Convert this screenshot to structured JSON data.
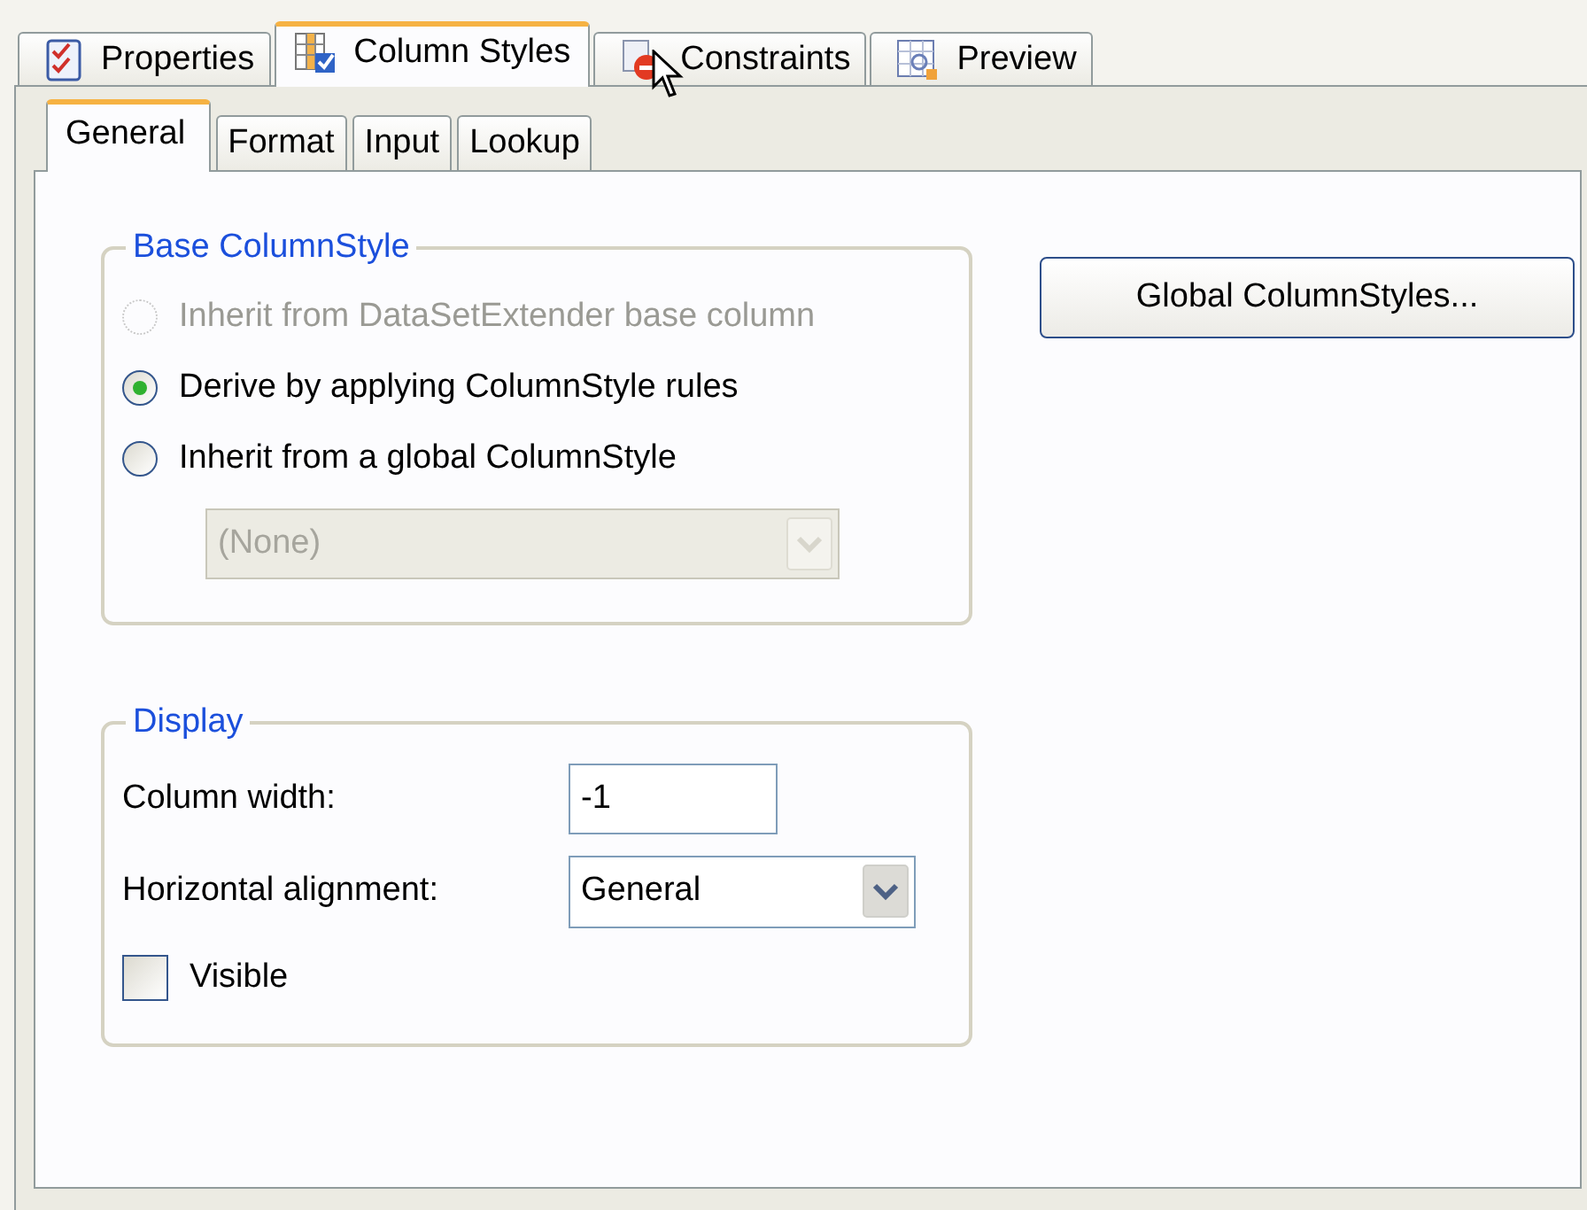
{
  "top_tabs": [
    {
      "label": "Properties",
      "selected": false
    },
    {
      "label": "Column Styles",
      "selected": true
    },
    {
      "label": "Constraints",
      "selected": false
    },
    {
      "label": "Preview",
      "selected": false
    }
  ],
  "sub_tabs": [
    {
      "label": "General",
      "selected": true
    },
    {
      "label": "Format",
      "selected": false
    },
    {
      "label": "Input",
      "selected": false
    },
    {
      "label": "Lookup",
      "selected": false
    }
  ],
  "base_group": {
    "title": "Base ColumnStyle",
    "options": [
      {
        "label": "Inherit from DataSetExtender base column",
        "selected": false,
        "disabled": true
      },
      {
        "label": "Derive by applying ColumnStyle rules",
        "selected": true,
        "disabled": false
      },
      {
        "label": "Inherit from a global ColumnStyle",
        "selected": false,
        "disabled": false
      }
    ],
    "style_dropdown": {
      "value": "(None)",
      "disabled": true
    }
  },
  "global_button": {
    "label": "Global ColumnStyles..."
  },
  "display_group": {
    "title": "Display",
    "column_width": {
      "label": "Column width:",
      "value": "-1"
    },
    "horizontal_alignment": {
      "label": "Horizontal alignment:",
      "value": "General"
    },
    "visible": {
      "label": "Visible",
      "checked": false
    }
  }
}
